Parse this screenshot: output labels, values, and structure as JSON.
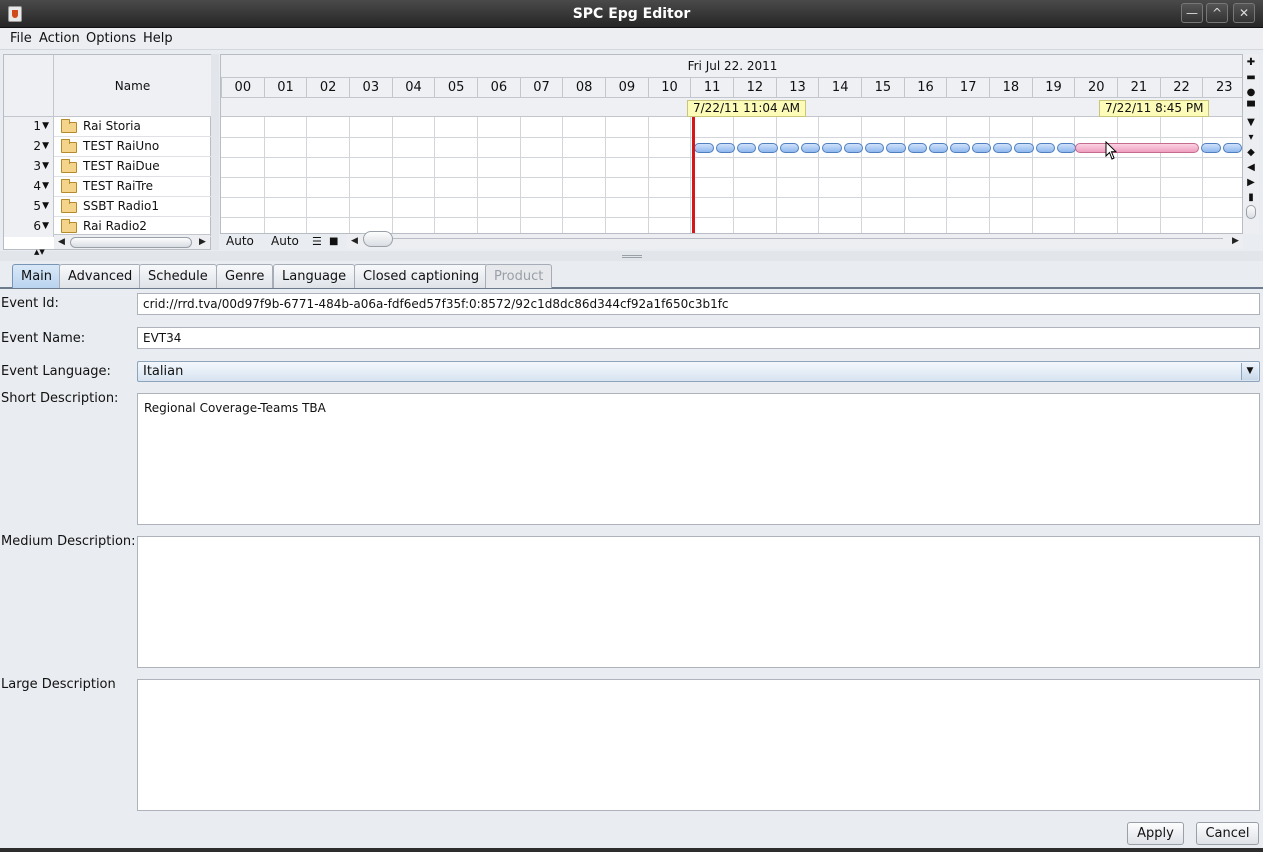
{
  "window": {
    "title": "SPC Epg Editor",
    "minimize_glyph": "—",
    "maximize_glyph": "^",
    "close_glyph": "✕"
  },
  "menu": [
    {
      "label": "File"
    },
    {
      "label": "Action"
    },
    {
      "label": "Options"
    },
    {
      "label": "Help"
    }
  ],
  "channels": {
    "name_header": "Name",
    "rows": [
      {
        "num": "1",
        "name": "Rai Storia"
      },
      {
        "num": "2",
        "name": "TEST RaiUno"
      },
      {
        "num": "3",
        "name": "TEST RaiDue"
      },
      {
        "num": "4",
        "name": "TEST RaiTre"
      },
      {
        "num": "5",
        "name": "SSBT Radio1"
      },
      {
        "num": "6",
        "name": "Rai Radio2"
      }
    ],
    "expand_glyph": "▼"
  },
  "timeline": {
    "date": "Fri Jul 22. 2011",
    "hours": [
      "00",
      "01",
      "02",
      "03",
      "04",
      "05",
      "06",
      "07",
      "08",
      "09",
      "10",
      "11",
      "12",
      "13",
      "14",
      "15",
      "16",
      "17",
      "18",
      "19",
      "20",
      "21",
      "22",
      "23"
    ],
    "marker_now": "7/22/11 11:04 AM",
    "marker_cursor": "7/22/11 8:45 PM",
    "now_hour": 11.07,
    "selected_event": {
      "start_hour": 20.0,
      "end_hour": 22.95
    },
    "auto_label_1": "Auto",
    "auto_label_2": "Auto",
    "accent_now_line": "#d21818",
    "event_color": "#8fb8ee",
    "selected_event_color": "#ee9ec0"
  },
  "tabs": [
    {
      "label": "Main",
      "state": "active"
    },
    {
      "label": "Advanced",
      "state": "normal"
    },
    {
      "label": "Schedule",
      "state": "normal"
    },
    {
      "label": "Genre",
      "state": "normal"
    },
    {
      "label": "Language",
      "state": "normal"
    },
    {
      "label": "Closed captioning",
      "state": "normal"
    },
    {
      "label": "Product",
      "state": "disabled"
    }
  ],
  "form": {
    "event_id_label": "Event Id:",
    "event_id_value": "crid://rrd.tva/00d97f9b-6771-484b-a06a-fdf6ed57f35f:0:8572/92c1d8dc86d344cf92a1f650c3b1fc",
    "event_name_label": "Event Name:",
    "event_name_value": "EVT34",
    "event_language_label": "Event Language:",
    "event_language_value": "Italian",
    "short_desc_label": "Short Description:",
    "short_desc_value": "Regional Coverage-Teams TBA",
    "medium_desc_label": "Medium Description:",
    "medium_desc_value": "",
    "large_desc_label": "Large Description",
    "large_desc_value": ""
  },
  "buttons": {
    "apply": "Apply",
    "cancel": "Cancel"
  }
}
